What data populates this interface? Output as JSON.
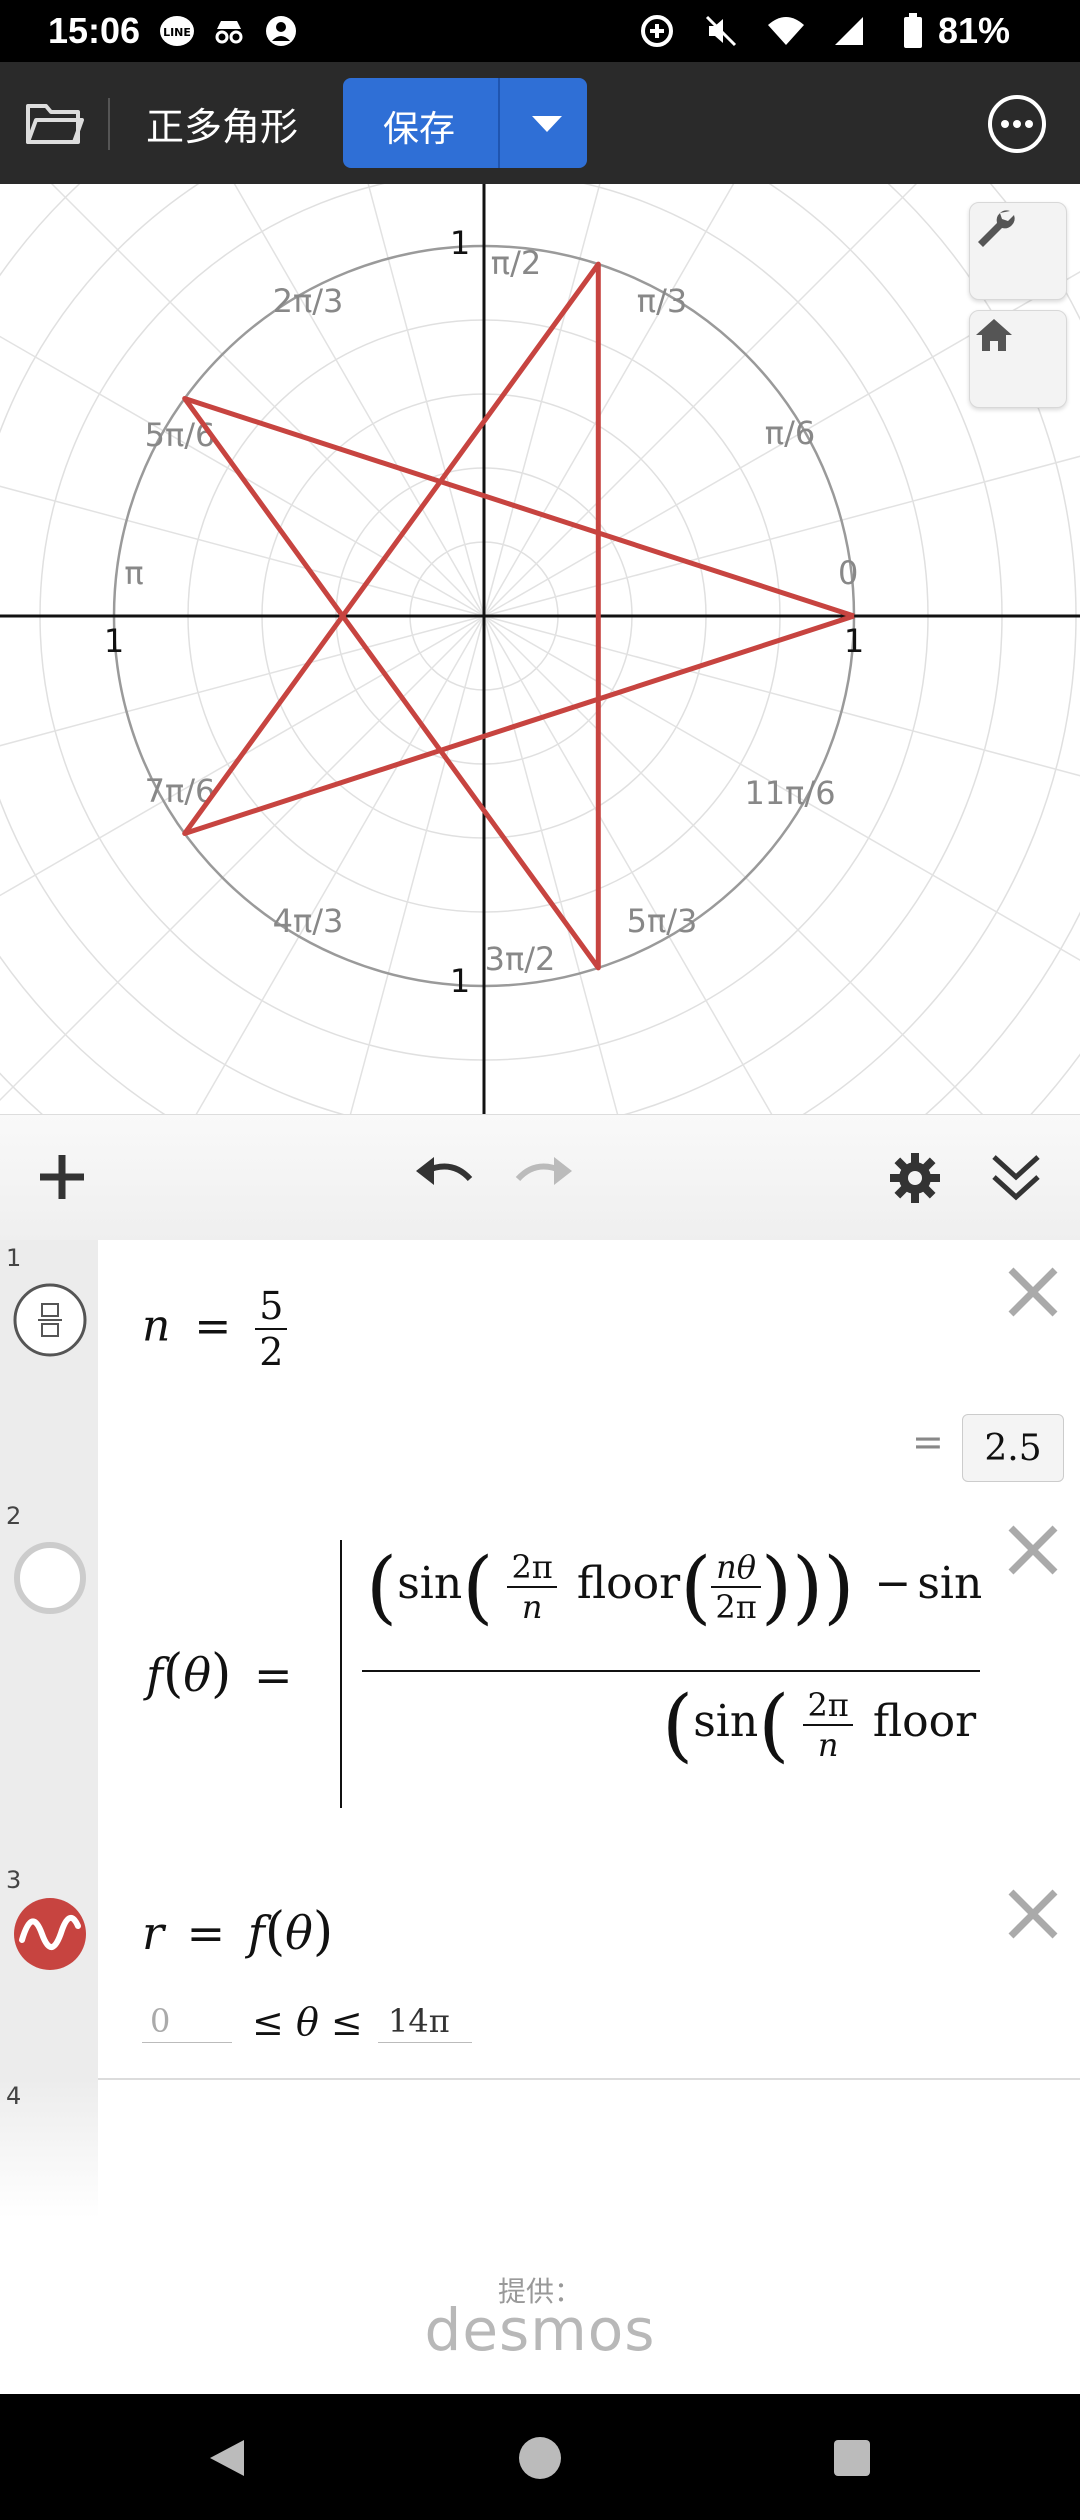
{
  "status_bar": {
    "time": "15:06",
    "battery": "81%"
  },
  "app_bar": {
    "title": "正多角形",
    "save_label": "保存"
  },
  "graph": {
    "axis_labels": {
      "x_pos": "1",
      "x_neg": "1",
      "y_pos": "1",
      "y_neg": "1"
    },
    "angle_labels": [
      "0",
      "π/6",
      "π/3",
      "π/2",
      "2π/3",
      "5π/6",
      "π",
      "7π/6",
      "4π/3",
      "3π/2",
      "5π/3",
      "11π/6"
    ],
    "curve_color": "#c74440"
  },
  "expressions": [
    {
      "index": "1",
      "lhs": "n",
      "eq": "=",
      "num": "5",
      "den": "2",
      "result_eq": "=",
      "result": "2.5"
    },
    {
      "index": "2",
      "lhs": "f",
      "arg": "θ",
      "eq": "=",
      "top": {
        "sin1": "sin",
        "two_pi": "2π",
        "n": "n",
        "floor": "floor",
        "ntheta": "nθ",
        "two_pi_b": "2π",
        "minus": "−",
        "sin2": "sin"
      },
      "bottom": {
        "sin": "sin",
        "two_pi": "2π",
        "n": "n",
        "floor": "floor"
      }
    },
    {
      "index": "3",
      "lhs": "r",
      "eq": "=",
      "rhs_f": "f",
      "rhs_arg": "θ",
      "min": "0",
      "max": "14π",
      "le1": "≤",
      "theta": "θ",
      "le2": "≤"
    },
    {
      "index": "4"
    }
  ],
  "footer": {
    "provided_by": "提供：",
    "brand": "desmos"
  }
}
